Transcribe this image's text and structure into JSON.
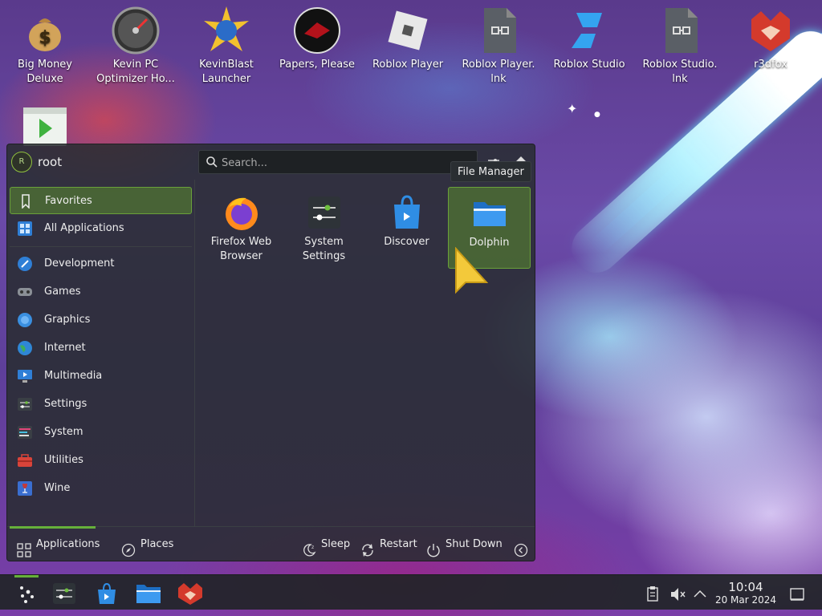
{
  "desktop": {
    "icons": [
      {
        "label": "Big Money Deluxe"
      },
      {
        "label": "Kevin PC Optimizer Ho..."
      },
      {
        "label": "KevinBlast Launcher"
      },
      {
        "label": "Papers, Please"
      },
      {
        "label": "Roblox Player"
      },
      {
        "label": "Roblox Player. lnk"
      },
      {
        "label": "Roblox Studio"
      },
      {
        "label": "Roblox Studio. lnk"
      },
      {
        "label": "r3dfox"
      }
    ]
  },
  "menu": {
    "user": {
      "initial": "R",
      "name": "root"
    },
    "search": {
      "placeholder": "Search..."
    },
    "categories": [
      {
        "label": "Favorites",
        "icon": "bookmark-icon"
      },
      {
        "label": "All Applications",
        "icon": "grid-icon"
      },
      {
        "label": "Development",
        "icon": "development-icon"
      },
      {
        "label": "Games",
        "icon": "gamepad-icon"
      },
      {
        "label": "Graphics",
        "icon": "graphics-icon"
      },
      {
        "label": "Internet",
        "icon": "globe-icon"
      },
      {
        "label": "Multimedia",
        "icon": "multimedia-icon"
      },
      {
        "label": "Settings",
        "icon": "settings-icon"
      },
      {
        "label": "System",
        "icon": "system-icon"
      },
      {
        "label": "Utilities",
        "icon": "toolbox-icon"
      },
      {
        "label": "Wine",
        "icon": "wine-icon"
      }
    ],
    "favorites": [
      {
        "label": "Firefox Web Browser",
        "icon": "firefox-icon"
      },
      {
        "label": "System Settings",
        "icon": "system-settings-icon"
      },
      {
        "label": "Discover",
        "icon": "discover-icon"
      },
      {
        "label": "Dolphin",
        "icon": "dolphin-folder-icon"
      }
    ],
    "tooltip": "File Manager",
    "footer": {
      "applications": "Applications",
      "places": "Places",
      "sleep": "Sleep",
      "restart": "Restart",
      "shutdown": "Shut Down"
    }
  },
  "taskbar": {
    "time": "10:04",
    "date": "20 Mar 2024"
  },
  "colors": {
    "accent": "#66b03a",
    "selection": "#5b8e2e",
    "panel": "#282c30"
  }
}
